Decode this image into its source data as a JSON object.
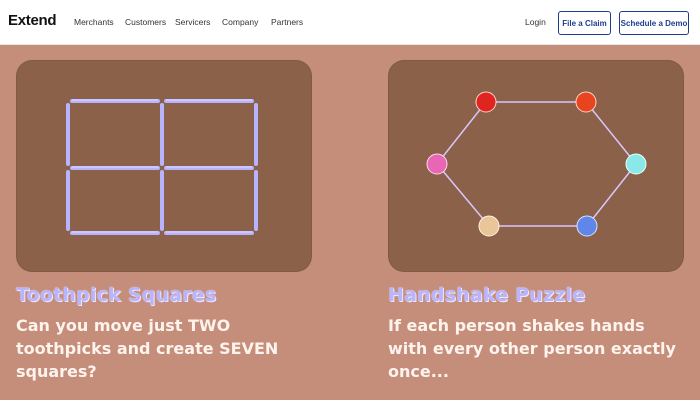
{
  "nav": {
    "logo": "Extend",
    "links": [
      "Merchants",
      "Customers",
      "Servicers",
      "Company",
      "Partners"
    ],
    "login": "Login",
    "file_claim": "File a Claim",
    "schedule_demo": "Schedule a Demo"
  },
  "cards": [
    {
      "title": "Toothpick Squares",
      "description": "Can you move just TWO toothpicks and create SEVEN squares?"
    },
    {
      "title": "Handshake Puzzle",
      "description": "If each person shakes hands with every other person exactly once..."
    }
  ],
  "colors": {
    "page_background": "#c48e7b",
    "card_background": "#8b6249",
    "title_color": "#b9b4ff",
    "button_color": "#1f3d8f",
    "toothpick_color": "#b8b3ff",
    "handshake_nodes": [
      "#e0241f",
      "#e8451f",
      "#e866b4",
      "#8ce8e8",
      "#e8c69a",
      "#5f86e8"
    ]
  }
}
